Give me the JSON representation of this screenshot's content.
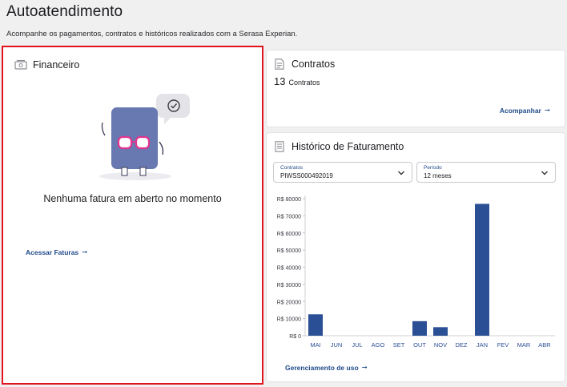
{
  "page": {
    "title": "Autoatendimento",
    "subtitle": "Acompanhe os pagamentos, contratos e históricos realizados com a Serasa Experian."
  },
  "financeiro": {
    "title": "Financeiro",
    "empty_message": "Nenhuma fatura em aberto no momento",
    "link_label": "Acessar Faturas",
    "link_arrow": "➞"
  },
  "contratos": {
    "title": "Contratos",
    "count": "13",
    "count_label": "Contratos",
    "link_label": "Acompanhar",
    "link_arrow": "➞"
  },
  "historico": {
    "title": "Histórico de Faturamento",
    "select_contracts": {
      "label": "Contratos",
      "value": "PIWSS000492019"
    },
    "select_period": {
      "label": "Período",
      "value": "12 meses"
    },
    "link_label": "Gerenciamento de uso",
    "link_arrow": "➞"
  },
  "colors": {
    "bar": "#2b4f95",
    "link": "#1f4a8a",
    "highlight_border": "#e1141e",
    "mascot_body": "#6878b0",
    "mascot_glasses": "#e0358f"
  },
  "chart_data": {
    "type": "bar",
    "categories": [
      "MAI",
      "JUN",
      "JUL",
      "AGO",
      "SET",
      "OUT",
      "NOV",
      "DEZ",
      "JAN",
      "FEV",
      "MAR",
      "ABR"
    ],
    "values": [
      12500,
      0,
      0,
      0,
      0,
      8500,
      5000,
      0,
      77000,
      0,
      0,
      0
    ],
    "ylim": [
      0,
      80000
    ],
    "yticks": [
      0,
      10000,
      20000,
      30000,
      40000,
      50000,
      60000,
      70000,
      80000
    ],
    "ytick_labels": [
      "R$ 0",
      "R$ 10000",
      "R$ 20000",
      "R$ 30000",
      "R$ 40000",
      "R$ 50000",
      "R$ 60000",
      "R$ 70000",
      "R$ 80000"
    ],
    "grid": false,
    "title": "",
    "xlabel": "",
    "ylabel": ""
  }
}
